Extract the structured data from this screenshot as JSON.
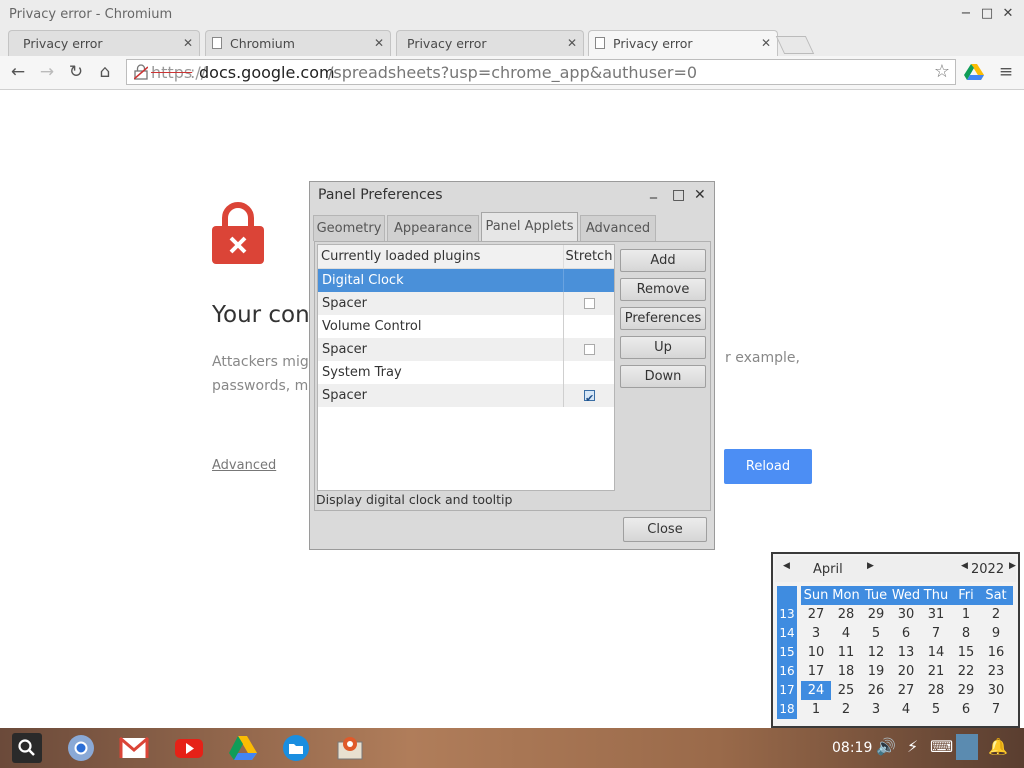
{
  "window": {
    "title": "Privacy error - Chromium",
    "minimize": "−",
    "maximize": "□",
    "close": "✕"
  },
  "tabs": [
    {
      "label": "Privacy error",
      "active": false,
      "icon": false
    },
    {
      "label": "Chromium",
      "active": false,
      "icon": true
    },
    {
      "label": "Privacy error",
      "active": false,
      "icon": true
    },
    {
      "label": "Privacy error",
      "active": true,
      "icon": true
    }
  ],
  "tab_close": "✕",
  "toolbar": {
    "back": "←",
    "forward": "→",
    "reload": "↻",
    "home": "⌂",
    "menu": "≡",
    "star": "☆"
  },
  "omnibox": {
    "scheme": "https",
    "sep": "://",
    "host": "docs.google.com",
    "path": "/spreadsheets?usp=chrome_app&authuser=0"
  },
  "page": {
    "heading": "Your con",
    "para_line1": "Attackers migh",
    "para_line2": "passwords, me",
    "para_right": "r example,",
    "advanced": "Advanced",
    "reload": "Reload"
  },
  "dialog": {
    "title": "Panel Preferences",
    "controls": {
      "minimize": "_",
      "maximize": "□",
      "close": "✕"
    },
    "tabs": [
      "Geometry",
      "Appearance",
      "Panel Applets",
      "Advanced"
    ],
    "active_tab": "Panel Applets",
    "columns": {
      "name": "Currently loaded plugins",
      "stretch": "Stretch"
    },
    "plugins": [
      {
        "name": "Digital Clock",
        "stretch": null,
        "selected": true
      },
      {
        "name": "Spacer",
        "stretch": false,
        "selected": false
      },
      {
        "name": "Volume Control",
        "stretch": null,
        "selected": false
      },
      {
        "name": "Spacer",
        "stretch": false,
        "selected": false
      },
      {
        "name": "System Tray",
        "stretch": null,
        "selected": false
      },
      {
        "name": "Spacer",
        "stretch": true,
        "selected": false
      }
    ],
    "buttons": {
      "add": "Add",
      "remove": "Remove",
      "preferences": "Preferences",
      "up": "Up",
      "down": "Down"
    },
    "description": "Display digital clock and tooltip",
    "close": "Close"
  },
  "calendar": {
    "month": "April",
    "year": "2022",
    "weekdays": [
      "Sun",
      "Mon",
      "Tue",
      "Wed",
      "Thu",
      "Fri",
      "Sat"
    ],
    "weeks": [
      {
        "num": "13",
        "days": [
          "27",
          "28",
          "29",
          "30",
          "31",
          "1",
          "2"
        ]
      },
      {
        "num": "14",
        "days": [
          "3",
          "4",
          "5",
          "6",
          "7",
          "8",
          "9"
        ]
      },
      {
        "num": "15",
        "days": [
          "10",
          "11",
          "12",
          "13",
          "14",
          "15",
          "16"
        ]
      },
      {
        "num": "16",
        "days": [
          "17",
          "18",
          "19",
          "20",
          "21",
          "22",
          "23"
        ]
      },
      {
        "num": "17",
        "days": [
          "24",
          "25",
          "26",
          "27",
          "28",
          "29",
          "30"
        ]
      },
      {
        "num": "18",
        "days": [
          "1",
          "2",
          "3",
          "4",
          "5",
          "6",
          "7"
        ]
      }
    ],
    "today": "24"
  },
  "taskbar": {
    "time": "08:19",
    "apps": [
      "search-launcher",
      "chromium",
      "gmail",
      "youtube",
      "drive",
      "files",
      "lxde-settings"
    ],
    "tray": [
      "volume-icon",
      "network-icon",
      "keyboard-icon",
      "user-icon",
      "notification-icon"
    ]
  },
  "colors": {
    "accent": "#4c8ef4",
    "selection": "#4a90d9",
    "lock_red": "#db4437"
  }
}
